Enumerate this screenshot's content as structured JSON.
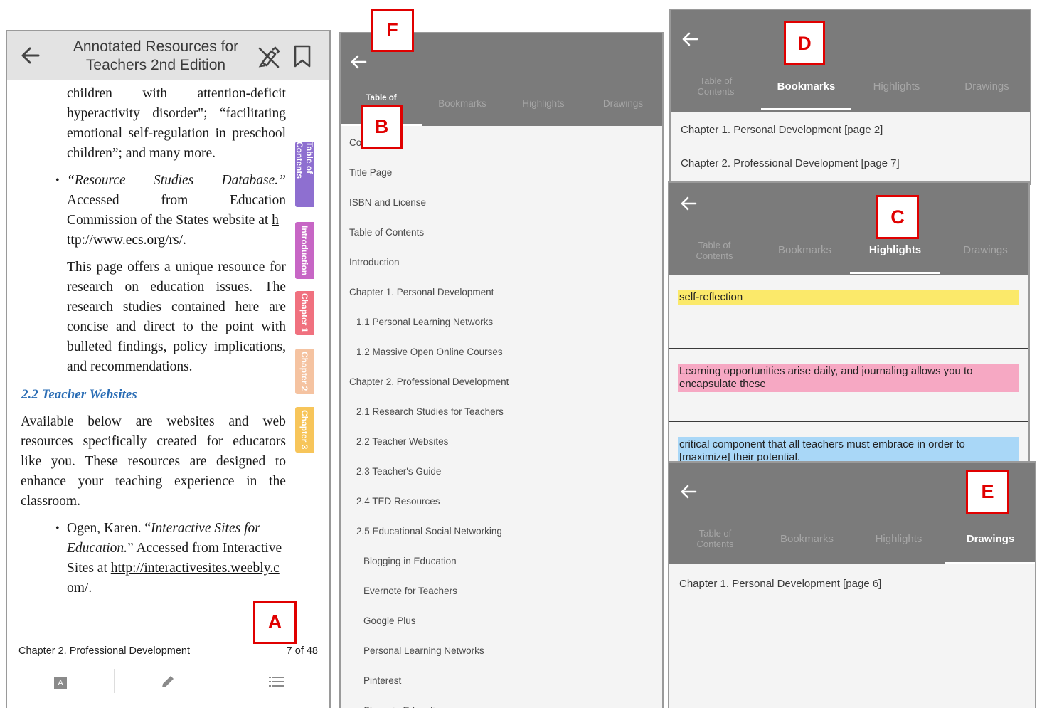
{
  "reader": {
    "title_line1": "Annotated Resources for",
    "title_line2": "Teachers 2nd Edition",
    "para1": [
      "children",
      "with",
      "attention-deficit"
    ],
    "para1_l2": [
      "hyperactivity",
      "disorder\";",
      "“facilitating"
    ],
    "para1_l3": [
      "emotional",
      "self-regulation",
      "in",
      "preschool"
    ],
    "para1_l4": "children”; and many more.",
    "b1_l1": [
      "“Resource",
      "Studies",
      "Database.”"
    ],
    "b1_l2": [
      "Accessed",
      "from",
      "Education"
    ],
    "b1_l3": "Commission of the States website at ",
    "b1_l3_link": "h",
    "b1_l4_link": "ttp://www.ecs.org/rs/",
    "b1_l4_tail": ".",
    "p2_l1": [
      "This",
      "page",
      "offers",
      "a",
      "unique",
      "resource",
      "for"
    ],
    "p2_l2": [
      "research",
      "on",
      "education",
      "issues.",
      "The"
    ],
    "p2_l3": [
      "research",
      "studies",
      "contained",
      "here",
      "are"
    ],
    "p2_l4": [
      "concise",
      "and",
      "direct",
      "to",
      "the",
      "point",
      "with"
    ],
    "p2_l5": [
      "bulleted",
      "findings,",
      "policy",
      "implications,"
    ],
    "p2_l6": "and recommendations.",
    "section_heading": "2.2 Teacher Websites",
    "p3_l1": [
      "Available",
      "below",
      "are",
      "websites",
      "and",
      "web"
    ],
    "p3_l2": [
      "resources",
      "specifically",
      "created",
      "for",
      "educators"
    ],
    "p3_l3": [
      "like",
      "you.",
      "These",
      "resources",
      "are",
      "designed",
      "to"
    ],
    "p3_l4": [
      "enhance",
      "your",
      "teaching",
      "experience",
      "in",
      "the"
    ],
    "p3_l5": "classroom.",
    "b2_l1_a": "Ogen,  Karen.  “",
    "b2_l1_it": "Interactive  Sites  for",
    "b2_l2_it": "Education.",
    "b2_l2_tail": "” Accessed from Interactive",
    "b2_l3": "Sites at ",
    "b2_l3_link": "http://interactivesites.weebly.c",
    "b2_l4_link": "om/",
    "b2_l4_tail": ".",
    "tabs": [
      "Table of Contents",
      "Introduction",
      "Chapter 1",
      "Chapter 2",
      "Chapter 3"
    ],
    "tab_colors": [
      "#8e6fd0",
      "#c766c5",
      "#f0717f",
      "#f5c3a1",
      "#f7c55a"
    ],
    "footer_chapter": "Chapter 2. Professional Development",
    "footer_page": "7 of 48",
    "toolbar_icons": [
      "font-size-icon",
      "pencil-icon",
      "list-icon"
    ],
    "toolbar_font_glyph": "A"
  },
  "toc": {
    "tabs": [
      "Table of",
      "Bookmarks",
      "Highlights",
      "Drawings"
    ],
    "cut_item": "Co",
    "items": [
      {
        "label": "Title Page",
        "level": 0
      },
      {
        "label": "ISBN and License",
        "level": 0
      },
      {
        "label": "Table of Contents",
        "level": 0
      },
      {
        "label": "Introduction",
        "level": 0
      },
      {
        "label": "Chapter 1. Personal Development",
        "level": 0
      },
      {
        "label": "1.1 Personal Learning Networks",
        "level": 1
      },
      {
        "label": "1.2 Massive Open Online Courses",
        "level": 1
      },
      {
        "label": "Chapter 2. Professional Development",
        "level": 0
      },
      {
        "label": "2.1 Research Studies for Teachers",
        "level": 1
      },
      {
        "label": "2.2 Teacher Websites",
        "level": 1
      },
      {
        "label": "2.3 Teacher's Guide",
        "level": 1
      },
      {
        "label": "2.4 TED Resources",
        "level": 1
      },
      {
        "label": "2.5 Educational Social Networking",
        "level": 1
      },
      {
        "label": "Blogging in Education",
        "level": 2
      },
      {
        "label": "Evernote for Teachers",
        "level": 2
      },
      {
        "label": "Google Plus",
        "level": 2
      },
      {
        "label": "Personal Learning Networks",
        "level": 2
      },
      {
        "label": "Pinterest",
        "level": 2
      },
      {
        "label": "Skype in Education",
        "level": 2
      }
    ]
  },
  "panel_tabs": {
    "toc_l1": "Table of",
    "toc_l2": "Contents",
    "bookmarks": "Bookmarks",
    "highlights": "Highlights",
    "drawings": "Drawings"
  },
  "bookmarks": {
    "items": [
      "Chapter 1. Personal Development [page 2]",
      "Chapter 2. Professional Development [page 7]"
    ]
  },
  "highlights": {
    "items": [
      {
        "text": "self-reflection",
        "color": "#fbe96a"
      },
      {
        "text": "Learning opportunities arise daily, and journaling allows you to encapsulate these",
        "color": "#f6a8c3"
      },
      {
        "text": "critical component that all teachers must embrace in order to [maximize] their potential.",
        "color": "#a9d7f7"
      }
    ]
  },
  "drawings": {
    "items": [
      "Chapter 1. Personal Development [page 6]"
    ]
  },
  "callouts": {
    "a": "A",
    "b": "B",
    "c": "C",
    "d": "D",
    "e": "E",
    "f": "F"
  },
  "colors": {
    "header_gray": "#7b7b7b",
    "callout_red": "#e00000",
    "link_blue": "#2a6db5"
  }
}
